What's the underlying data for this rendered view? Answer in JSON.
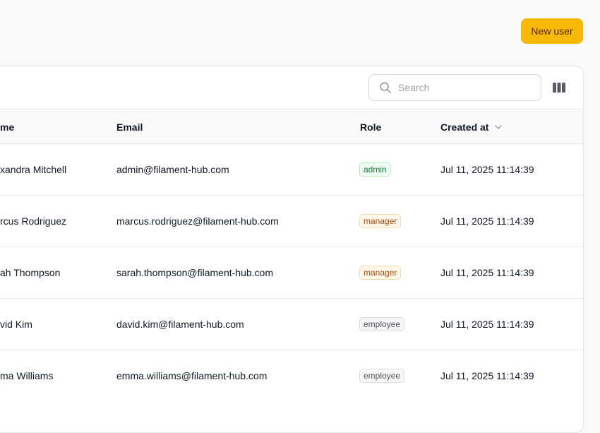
{
  "header": {
    "new_user_label": "New user"
  },
  "toolbar": {
    "search_placeholder": "Search",
    "search_value": ""
  },
  "table": {
    "columns": {
      "name": "me",
      "email": "Email",
      "role": "Role",
      "created_at": "Created at"
    },
    "rows": [
      {
        "name": "xandra Mitchell",
        "email": "admin@filament-hub.com",
        "role": "admin",
        "created_at": "Jul 11, 2025 11:14:39"
      },
      {
        "name": "rcus Rodriguez",
        "email": "marcus.rodriguez@filament-hub.com",
        "role": "manager",
        "created_at": "Jul 11, 2025 11:14:39"
      },
      {
        "name": "ah Thompson",
        "email": "sarah.thompson@filament-hub.com",
        "role": "manager",
        "created_at": "Jul 11, 2025 11:14:39"
      },
      {
        "name": "vid Kim",
        "email": "david.kim@filament-hub.com",
        "role": "employee",
        "created_at": "Jul 11, 2025 11:14:39"
      },
      {
        "name": "ma Williams",
        "email": "emma.williams@filament-hub.com",
        "role": "employee",
        "created_at": "Jul 11, 2025 11:14:39"
      }
    ]
  },
  "icons": {
    "search": "search-icon",
    "columns": "columns-icon",
    "sort": "chevron-down-icon"
  },
  "colors": {
    "primary": "#f8b808",
    "admin_badge": "#167a3e",
    "manager_badge": "#a34d0c",
    "employee_badge": "#52525b"
  }
}
